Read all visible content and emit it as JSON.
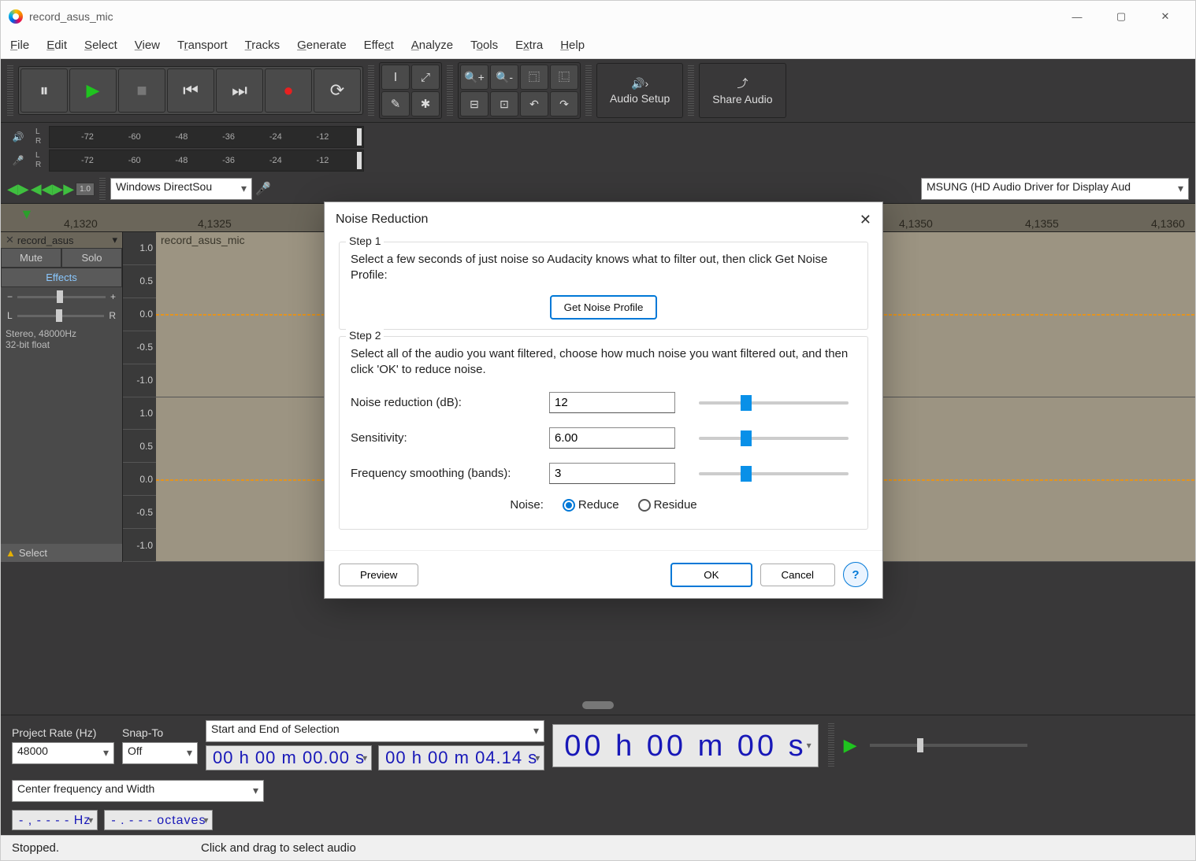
{
  "title": "record_asus_mic",
  "menu": [
    "File",
    "Edit",
    "Select",
    "View",
    "Transport",
    "Tracks",
    "Generate",
    "Effect",
    "Analyze",
    "Tools",
    "Extra",
    "Help"
  ],
  "audio_setup": "Audio Setup",
  "share_audio": "Share Audio",
  "meter_marks": [
    "-72",
    "-60",
    "-48",
    "-36",
    "-24",
    "-12"
  ],
  "devbar": {
    "host": "Windows DirectSou",
    "speaker": "MSUNG (HD Audio Driver for Display Aud"
  },
  "timeline": [
    "4,1320",
    "4,1325",
    "4,1350",
    "4,1355",
    "4,1360"
  ],
  "track": {
    "name": "record_asus",
    "label": "record_asus_mic",
    "mute": "Mute",
    "solo": "Solo",
    "effects": "Effects",
    "info1": "Stereo, 48000Hz",
    "info2": "32-bit float",
    "select": "Select"
  },
  "amp": [
    "1.0",
    "0.5",
    "0.0",
    "-0.5",
    "-1.0"
  ],
  "selbar": {
    "pr": "Project Rate (Hz)",
    "snap": "Snap-To",
    "range": "Start and End of Selection",
    "rate": "48000",
    "off": "Off",
    "t1": "00 h 00 m 00.00 s",
    "t2": "00 h 00 m 04.14 s",
    "big": "00 h 00 m 00 s",
    "cf": "Center frequency and Width",
    "hz": "- , - - -   -  Hz",
    "oct": "- . - - -   octaves"
  },
  "status": {
    "s1": "Stopped.",
    "s2": "Click and drag to select audio"
  },
  "dlg": {
    "title": "Noise Reduction",
    "step1": "Step 1",
    "s1txt": "Select a few seconds of just noise so Audacity knows what to filter out, then click Get Noise Profile:",
    "gnp": "Get Noise Profile",
    "step2": "Step 2",
    "s2txt": "Select all of the audio you want filtered, choose how much noise you want filtered out, and then click 'OK' to reduce noise.",
    "nr_l": "Noise reduction (dB):",
    "nr_v": "12",
    "se_l": "Sensitivity:",
    "se_v": "6.00",
    "fs_l": "Frequency smoothing (bands):",
    "fs_v": "3",
    "noise": "Noise:",
    "reduce": "Reduce",
    "residue": "Residue",
    "preview": "Preview",
    "ok": "OK",
    "cancel": "Cancel"
  }
}
